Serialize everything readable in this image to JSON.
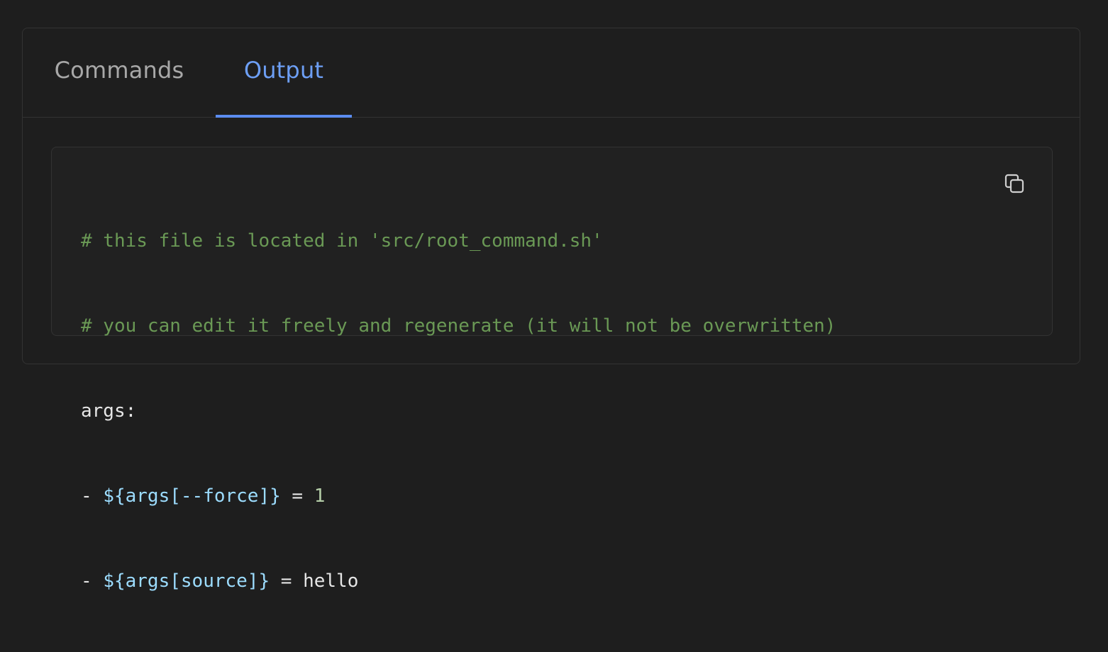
{
  "tabs": {
    "commands_label": "Commands",
    "output_label": "Output",
    "active": "Output"
  },
  "code": {
    "line1": "# this file is located in 'src/root_command.sh'",
    "line2": "# you can edit it freely and regenerate (it will not be overwritten)",
    "line3": "args:",
    "line4": {
      "dash": "- ",
      "var": "${args[--force]}",
      "eq": " = ",
      "value": "1"
    },
    "line5": {
      "dash": "- ",
      "var": "${args[source]}",
      "eq": " = ",
      "value": "hello"
    }
  },
  "copy_button": {
    "icon": "copy-icon"
  },
  "colors": {
    "background": "#1e1e1e",
    "active_tab": "#6d9ff5",
    "inactive_tab": "#a8a8a8",
    "comment": "#6a9955",
    "variable": "#9cdcfe",
    "number": "#b5cea8",
    "text": "#e6e6e6"
  }
}
